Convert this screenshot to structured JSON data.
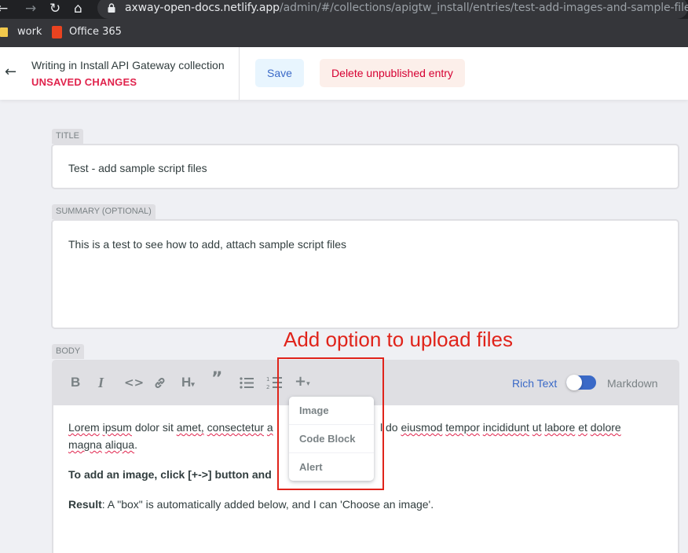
{
  "browser": {
    "url_domain": "axway-open-docs.netlify.app",
    "url_path": "/admin/#/collections/apigtw_install/entries/test-add-images-and-sample-files",
    "bookmarks": [
      {
        "label": "work",
        "icon": "folder-icon"
      },
      {
        "label": "Office 365",
        "icon": "office-icon"
      }
    ]
  },
  "header": {
    "collection_text": "Writing in Install API Gateway collection",
    "status": "UNSAVED CHANGES",
    "save_label": "Save",
    "delete_label": "Delete unpublished entry"
  },
  "fields": {
    "title": {
      "label": "TITLE",
      "value": "Test - add sample script files"
    },
    "summary": {
      "label": "SUMMARY (OPTIONAL)",
      "value": "This is a test to see how to add, attach sample script files"
    },
    "body": {
      "label": "BODY"
    }
  },
  "toolbar": {
    "icons": [
      "bold-icon",
      "italic-icon",
      "code-icon",
      "link-icon",
      "heading-icon",
      "quote-icon",
      "bulleted-list-icon",
      "numbered-list-icon",
      "add-component-icon"
    ],
    "rich_text_label": "Rich Text",
    "markdown_label": "Markdown",
    "mode_toggle_on": false
  },
  "dropdown": {
    "items": [
      "Image",
      "Code Block",
      "Alert"
    ]
  },
  "body_text": {
    "p1_line1_a": "Lorem",
    "p1_line1_b": "ipsum",
    "p1_line1_c": "dolor sit",
    "p1_line1_d": "amet,",
    "p1_line1_e": "consectetur",
    "p1_line1_f": "a",
    "p1_line1_g": "l do",
    "p1_line1_h": "eiusmod",
    "p1_line1_i": "tempor",
    "p1_line1_j": "incididunt",
    "p1_line1_k": "ut",
    "p1_line1_l": "labore",
    "p1_line1_m": "et",
    "p1_line1_n": "dolore",
    "p1_line2_a": "magna",
    "p1_line2_b": "aliqua",
    "p1_line2_c": ".",
    "p2": "To add an image, click [+->] button and",
    "p3_bold": "Result",
    "p3_rest": ": A \"box\" is automatically added below, and I can 'Choose an image'."
  },
  "annotation": {
    "text": "Add option to upload files"
  }
}
